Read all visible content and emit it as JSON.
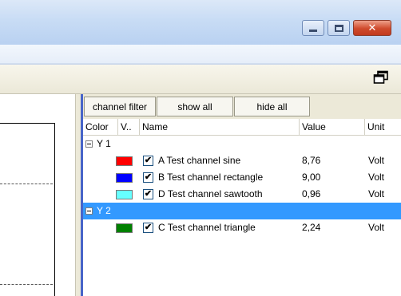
{
  "window": {
    "buttons": {
      "minimize": "minimize-icon",
      "maximize": "maximize-icon",
      "close": "close-icon"
    },
    "close_glyph": "✕"
  },
  "toolbar": {
    "restore_icon": "restore-window-icon"
  },
  "channel_panel": {
    "filter_buttons": {
      "channel_filter": "channel filter",
      "show_all": "show all",
      "hide_all": "hide all"
    },
    "columns": {
      "color": "Color",
      "visible": "V..",
      "name": "Name",
      "value": "Value",
      "unit": "Unit"
    },
    "groups": [
      {
        "label": "Y 1",
        "selected": false,
        "channels": [
          {
            "color": "#ff0000",
            "checked": true,
            "check_glyph": "✔",
            "name": "A Test channel sine",
            "value": "8,76",
            "unit": "Volt"
          },
          {
            "color": "#0000ff",
            "checked": true,
            "check_glyph": "✔",
            "name": "B Test channel rectangle",
            "value": "9,00",
            "unit": "Volt"
          },
          {
            "color": "#66ffff",
            "checked": true,
            "check_glyph": "✔",
            "name": "D Test channel sawtooth",
            "value": "0,96",
            "unit": "Volt"
          }
        ]
      },
      {
        "label": "Y 2",
        "selected": true,
        "channels": [
          {
            "color": "#008000",
            "checked": true,
            "check_glyph": "✔",
            "name": "C Test channel triangle",
            "value": "2,24",
            "unit": "Volt"
          }
        ]
      }
    ]
  },
  "colors": {
    "selection": "#3399ff",
    "panel_edge": "#4865c9"
  }
}
